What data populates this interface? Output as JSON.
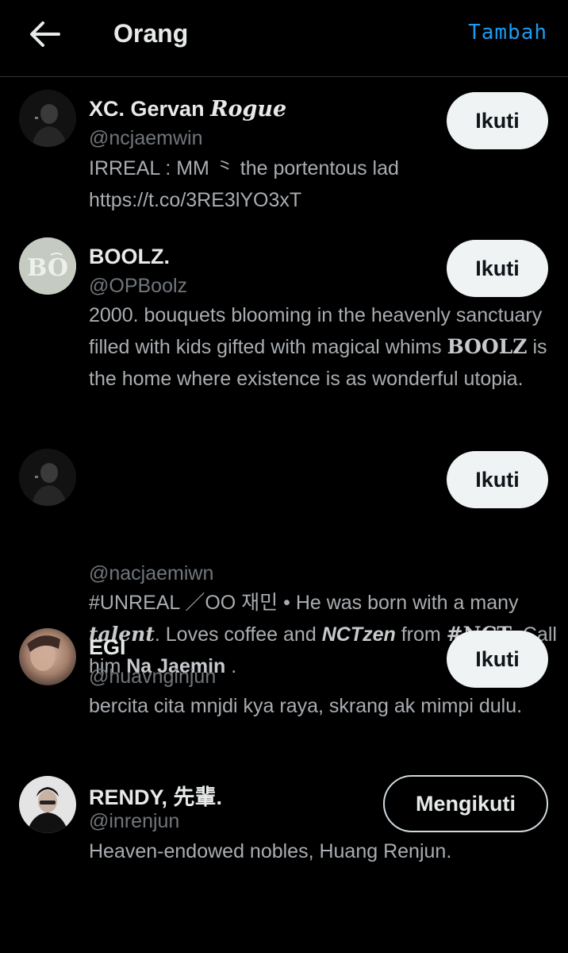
{
  "header": {
    "title": "Orang",
    "add_label": "Tambah",
    "back_icon": "arrow-left-icon"
  },
  "users": [
    {
      "name": "XC. Gervan ",
      "name_deco": "Rogue",
      "handle": "@ncjaemwin",
      "bio_line1": "IRREAL : MM ⺀ the portentous lad",
      "bio_line2": "https://t.co/3RE3lYO3xT",
      "button": "Ikuti"
    },
    {
      "name": "BOOLZ.",
      "avatar_text": "BO",
      "handle": "@OPBoolz",
      "bio_a": "2000. bouquets blooming in the heavenly sanctuary filled with kids gifted with magical whims ",
      "bio_b": "BOOLZ",
      "bio_c": " is the home where existence is as wonderful utopia.",
      "button": "Ikuti"
    },
    {
      "name": "",
      "handle": "@nacjaemiwn",
      "bio_a": "#UNREAL ／OO 재민 • He was born with a many ",
      "bio_b": "talent",
      "bio_c": ". Loves coffee and ",
      "bio_d": "NCTzen",
      "bio_e": " from ",
      "bio_f": "#NCT",
      "bio_g": ". Call him ",
      "bio_h": "Na Jaemin",
      "bio_i": " .",
      "button": "Ikuti"
    },
    {
      "name": "EGI",
      "handle": "@huavnginjun",
      "bio": "bercita cita mnjdi kya raya, skrang ak mimpi dulu.",
      "button": "Ikuti"
    },
    {
      "name": "RENDY, 先輩.",
      "handle": "@inrenjun",
      "bio": "Heaven-endowed nobles, Huang Renjun.",
      "button": "Mengikuti"
    }
  ],
  "colors": {
    "background": "#000000",
    "accent": "#1d9bf0",
    "primary_text": "#e7e9ea",
    "secondary_text": "#71767b"
  }
}
